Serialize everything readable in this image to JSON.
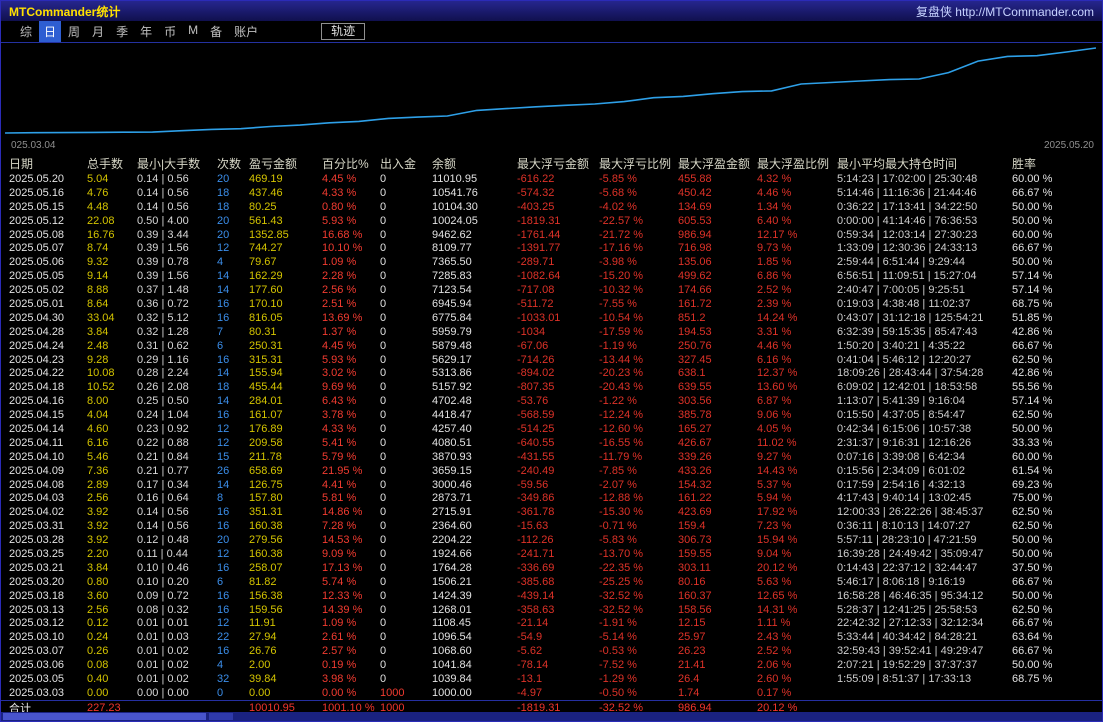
{
  "window": {
    "title": "MTCommander统计",
    "right_text": "复盘侠 http://MTCommander.com"
  },
  "menu": {
    "items": [
      {
        "label": "综",
        "key": "summary"
      },
      {
        "label": "日",
        "key": "day"
      },
      {
        "label": "周",
        "key": "week"
      },
      {
        "label": "月",
        "key": "month"
      },
      {
        "label": "季",
        "key": "quarter"
      },
      {
        "label": "年",
        "key": "year"
      },
      {
        "label": "币",
        "key": "currency"
      },
      {
        "label": "M",
        "key": "m"
      },
      {
        "label": "备",
        "key": "note"
      },
      {
        "label": "账户",
        "key": "account"
      }
    ],
    "active_index": 1,
    "track_button": "轨迹"
  },
  "chart": {
    "start_label": "025.03.04",
    "end_label": "2025.05.20",
    "line_color": "#2ea0e8"
  },
  "chart_data": {
    "type": "line",
    "title": "",
    "xlabel": "",
    "ylabel": "",
    "grid": false,
    "legend": false,
    "x_axis_labels_shown": [
      "025.03.04",
      "2025.05.20"
    ],
    "ylim": [
      1000,
      11011
    ],
    "x": [
      "2025.03.03",
      "2025.03.05",
      "2025.03.06",
      "2025.03.07",
      "2025.03.10",
      "2025.03.12",
      "2025.03.13",
      "2025.03.18",
      "2025.03.20",
      "2025.03.21",
      "2025.03.25",
      "2025.03.28",
      "2025.03.31",
      "2025.04.02",
      "2025.04.03",
      "2025.04.08",
      "2025.04.09",
      "2025.04.10",
      "2025.04.11",
      "2025.04.14",
      "2025.04.15",
      "2025.04.16",
      "2025.04.18",
      "2025.04.22",
      "2025.04.23",
      "2025.04.24",
      "2025.04.28",
      "2025.04.30",
      "2025.05.01",
      "2025.05.02",
      "2025.05.05",
      "2025.05.06",
      "2025.05.07",
      "2025.05.08",
      "2025.05.12",
      "2025.05.15",
      "2025.05.16",
      "2025.05.20"
    ],
    "values": [
      1000.0,
      1039.84,
      1041.84,
      1068.6,
      1096.54,
      1108.45,
      1268.01,
      1424.39,
      1506.21,
      1764.28,
      1924.66,
      2204.22,
      2364.6,
      2715.91,
      2873.71,
      3000.46,
      3659.15,
      3870.93,
      4080.51,
      4257.4,
      4418.47,
      4702.48,
      5157.92,
      5313.86,
      5629.17,
      5879.48,
      5959.79,
      6775.84,
      6945.94,
      7123.54,
      7285.83,
      7365.5,
      8109.77,
      9462.62,
      10024.05,
      10104.3,
      10541.76,
      11010.95
    ]
  },
  "table": {
    "headers": [
      "日期",
      "总手数",
      "最小|大手数",
      "次数",
      "盈亏金额",
      "百分比%",
      "出入金",
      "余额",
      "最大浮亏金额",
      "最大浮亏比例",
      "最大浮盈金额",
      "最大浮盈比例",
      "最小平均最大持仓时间",
      "胜率"
    ],
    "rows": [
      [
        "2025.05.20",
        "5.04",
        "0.14 | 0.56",
        "20",
        "469.19",
        "4.45 %",
        "0",
        "11010.95",
        "-616.22",
        "-5.85 %",
        "455.88",
        "4.32 %",
        "5:14:23 | 17:02:00 | 25:30:48",
        "60.00 %"
      ],
      [
        "2025.05.16",
        "4.76",
        "0.14 | 0.56",
        "18",
        "437.46",
        "4.33 %",
        "0",
        "10541.76",
        "-574.32",
        "-5.68 %",
        "450.42",
        "4.46 %",
        "5:14:46 | 11:16:36 | 21:44:46",
        "66.67 %"
      ],
      [
        "2025.05.15",
        "4.48",
        "0.14 | 0.56",
        "18",
        "80.25",
        "0.80 %",
        "0",
        "10104.30",
        "-403.25",
        "-4.02 %",
        "134.69",
        "1.34 %",
        "0:36:22 | 17:13:41 | 34:22:50",
        "50.00 %"
      ],
      [
        "2025.05.12",
        "22.08",
        "0.50 | 4.00",
        "20",
        "561.43",
        "5.93 %",
        "0",
        "10024.05",
        "-1819.31",
        "-22.57 %",
        "605.53",
        "6.40 %",
        "0:00:00 | 41:14:46 | 76:36:53",
        "50.00 %"
      ],
      [
        "2025.05.08",
        "16.76",
        "0.39 | 3.44",
        "20",
        "1352.85",
        "16.68 %",
        "0",
        "9462.62",
        "-1761.44",
        "-21.72 %",
        "986.94",
        "12.17 %",
        "0:59:34 | 12:03:14 | 27:30:23",
        "60.00 %"
      ],
      [
        "2025.05.07",
        "8.74",
        "0.39 | 1.56",
        "12",
        "744.27",
        "10.10 %",
        "0",
        "8109.77",
        "-1391.77",
        "-17.16 %",
        "716.98",
        "9.73 %",
        "1:33:09 | 12:30:36 | 24:33:13",
        "66.67 %"
      ],
      [
        "2025.05.06",
        "9.32",
        "0.39 | 0.78",
        "4",
        "79.67",
        "1.09 %",
        "0",
        "7365.50",
        "-289.71",
        "-3.98 %",
        "135.06",
        "1.85 %",
        "2:59:44 | 6:51:44 | 9:29:44",
        "50.00 %"
      ],
      [
        "2025.05.05",
        "9.14",
        "0.39 | 1.56",
        "14",
        "162.29",
        "2.28 %",
        "0",
        "7285.83",
        "-1082.64",
        "-15.20 %",
        "499.62",
        "6.86 %",
        "6:56:51 | 11:09:51 | 15:27:04",
        "57.14 %"
      ],
      [
        "2025.05.02",
        "8.88",
        "0.37 | 1.48",
        "14",
        "177.60",
        "2.56 %",
        "0",
        "7123.54",
        "-717.08",
        "-10.32 %",
        "174.66",
        "2.52 %",
        "2:40:47 | 7:00:05 | 9:25:51",
        "57.14 %"
      ],
      [
        "2025.05.01",
        "8.64",
        "0.36 | 0.72",
        "16",
        "170.10",
        "2.51 %",
        "0",
        "6945.94",
        "-511.72",
        "-7.55 %",
        "161.72",
        "2.39 %",
        "0:19:03 | 4:38:48 | 11:02:37",
        "68.75 %"
      ],
      [
        "2025.04.30",
        "33.04",
        "0.32 | 5.12",
        "16",
        "816.05",
        "13.69 %",
        "0",
        "6775.84",
        "-1033.01",
        "-10.54 %",
        "851.2",
        "14.24 %",
        "0:43:07 | 31:12:18 | 125:54:21",
        "51.85 %"
      ],
      [
        "2025.04.28",
        "3.84",
        "0.32 | 1.28",
        "7",
        "80.31",
        "1.37 %",
        "0",
        "5959.79",
        "-1034",
        "-17.59 %",
        "194.53",
        "3.31 %",
        "6:32:39 | 59:15:35 | 85:47:43",
        "42.86 %"
      ],
      [
        "2025.04.24",
        "2.48",
        "0.31 | 0.62",
        "6",
        "250.31",
        "4.45 %",
        "0",
        "5879.48",
        "-67.06",
        "-1.19 %",
        "250.76",
        "4.46 %",
        "1:50:20 | 3:40:21 | 4:35:22",
        "66.67 %"
      ],
      [
        "2025.04.23",
        "9.28",
        "0.29 | 1.16",
        "16",
        "315.31",
        "5.93 %",
        "0",
        "5629.17",
        "-714.26",
        "-13.44 %",
        "327.45",
        "6.16 %",
        "0:41:04 | 5:46:12 | 12:20:27",
        "62.50 %"
      ],
      [
        "2025.04.22",
        "10.08",
        "0.28 | 2.24",
        "14",
        "155.94",
        "3.02 %",
        "0",
        "5313.86",
        "-894.02",
        "-20.23 %",
        "638.1",
        "12.37 %",
        "18:09:26 | 28:43:44 | 37:54:28",
        "42.86 %"
      ],
      [
        "2025.04.18",
        "10.52",
        "0.26 | 2.08",
        "18",
        "455.44",
        "9.69 %",
        "0",
        "5157.92",
        "-807.35",
        "-20.43 %",
        "639.55",
        "13.60 %",
        "6:09:02 | 12:42:01 | 18:53:58",
        "55.56 %"
      ],
      [
        "2025.04.16",
        "8.00",
        "0.25 | 0.50",
        "14",
        "284.01",
        "6.43 %",
        "0",
        "4702.48",
        "-53.76",
        "-1.22 %",
        "303.56",
        "6.87 %",
        "1:13:07 | 5:41:39 | 9:16:04",
        "57.14 %"
      ],
      [
        "2025.04.15",
        "4.04",
        "0.24 | 1.04",
        "16",
        "161.07",
        "3.78 %",
        "0",
        "4418.47",
        "-568.59",
        "-12.24 %",
        "385.78",
        "9.06 %",
        "0:15:50 | 4:37:05 | 8:54:47",
        "62.50 %"
      ],
      [
        "2025.04.14",
        "4.60",
        "0.23 | 0.92",
        "12",
        "176.89",
        "4.33 %",
        "0",
        "4257.40",
        "-514.25",
        "-12.60 %",
        "165.27",
        "4.05 %",
        "0:42:34 | 6:15:06 | 10:57:38",
        "50.00 %"
      ],
      [
        "2025.04.11",
        "6.16",
        "0.22 | 0.88",
        "12",
        "209.58",
        "5.41 %",
        "0",
        "4080.51",
        "-640.55",
        "-16.55 %",
        "426.67",
        "11.02 %",
        "2:31:37 | 9:16:31 | 12:16:26",
        "33.33 %"
      ],
      [
        "2025.04.10",
        "5.46",
        "0.21 | 0.84",
        "15",
        "211.78",
        "5.79 %",
        "0",
        "3870.93",
        "-431.55",
        "-11.79 %",
        "339.26",
        "9.27 %",
        "0:07:16 | 3:39:08 | 6:42:34",
        "60.00 %"
      ],
      [
        "2025.04.09",
        "7.36",
        "0.21 | 0.77",
        "26",
        "658.69",
        "21.95 %",
        "0",
        "3659.15",
        "-240.49",
        "-7.85 %",
        "433.26",
        "14.43 %",
        "0:15:56 | 2:34:09 | 6:01:02",
        "61.54 %"
      ],
      [
        "2025.04.08",
        "2.89",
        "0.17 | 0.34",
        "14",
        "126.75",
        "4.41 %",
        "0",
        "3000.46",
        "-59.56",
        "-2.07 %",
        "154.32",
        "5.37 %",
        "0:17:59 | 2:54:16 | 4:32:13",
        "69.23 %"
      ],
      [
        "2025.04.03",
        "2.56",
        "0.16 | 0.64",
        "8",
        "157.80",
        "5.81 %",
        "0",
        "2873.71",
        "-349.86",
        "-12.88 %",
        "161.22",
        "5.94 %",
        "4:17:43 | 9:40:14 | 13:02:45",
        "75.00 %"
      ],
      [
        "2025.04.02",
        "3.92",
        "0.14 | 0.56",
        "16",
        "351.31",
        "14.86 %",
        "0",
        "2715.91",
        "-361.78",
        "-15.30 %",
        "423.69",
        "17.92 %",
        "12:00:33 | 26:22:26 | 38:45:37",
        "62.50 %"
      ],
      [
        "2025.03.31",
        "3.92",
        "0.14 | 0.56",
        "16",
        "160.38",
        "7.28 %",
        "0",
        "2364.60",
        "-15.63",
        "-0.71 %",
        "159.4",
        "7.23 %",
        "0:36:11 | 8:10:13 | 14:07:27",
        "62.50 %"
      ],
      [
        "2025.03.28",
        "3.92",
        "0.12 | 0.48",
        "20",
        "279.56",
        "14.53 %",
        "0",
        "2204.22",
        "-112.26",
        "-5.83 %",
        "306.73",
        "15.94 %",
        "5:57:11 | 28:23:10 | 47:21:59",
        "50.00 %"
      ],
      [
        "2025.03.25",
        "2.20",
        "0.11 | 0.44",
        "12",
        "160.38",
        "9.09 %",
        "0",
        "1924.66",
        "-241.71",
        "-13.70 %",
        "159.55",
        "9.04 %",
        "16:39:28 | 24:49:42 | 35:09:47",
        "50.00 %"
      ],
      [
        "2025.03.21",
        "3.84",
        "0.10 | 0.46",
        "16",
        "258.07",
        "17.13 %",
        "0",
        "1764.28",
        "-336.69",
        "-22.35 %",
        "303.11",
        "20.12 %",
        "0:14:43 | 22:37:12 | 32:44:47",
        "37.50 %"
      ],
      [
        "2025.03.20",
        "0.80",
        "0.10 | 0.20",
        "6",
        "81.82",
        "5.74 %",
        "0",
        "1506.21",
        "-385.68",
        "-25.25 %",
        "80.16",
        "5.63 %",
        "5:46:17 | 8:06:18 | 9:16:19",
        "66.67 %"
      ],
      [
        "2025.03.18",
        "3.60",
        "0.09 | 0.72",
        "16",
        "156.38",
        "12.33 %",
        "0",
        "1424.39",
        "-439.14",
        "-32.52 %",
        "160.37",
        "12.65 %",
        "16:58:28 | 46:46:35 | 95:34:12",
        "50.00 %"
      ],
      [
        "2025.03.13",
        "2.56",
        "0.08 | 0.32",
        "16",
        "159.56",
        "14.39 %",
        "0",
        "1268.01",
        "-358.63",
        "-32.52 %",
        "158.56",
        "14.31 %",
        "5:28:37 | 12:41:25 | 25:58:53",
        "62.50 %"
      ],
      [
        "2025.03.12",
        "0.12",
        "0.01 | 0.01",
        "12",
        "11.91",
        "1.09 %",
        "0",
        "1108.45",
        "-21.14",
        "-1.91 %",
        "12.15",
        "1.11 %",
        "22:42:32 | 27:12:33 | 32:12:34",
        "66.67 %"
      ],
      [
        "2025.03.10",
        "0.24",
        "0.01 | 0.03",
        "22",
        "27.94",
        "2.61 %",
        "0",
        "1096.54",
        "-54.9",
        "-5.14 %",
        "25.97",
        "2.43 %",
        "5:33:44 | 40:34:42 | 84:28:21",
        "63.64 %"
      ],
      [
        "2025.03.07",
        "0.26",
        "0.01 | 0.02",
        "16",
        "26.76",
        "2.57 %",
        "0",
        "1068.60",
        "-5.62",
        "-0.53 %",
        "26.23",
        "2.52 %",
        "32:59:43 | 39:52:41 | 49:29:47",
        "66.67 %"
      ],
      [
        "2025.03.06",
        "0.08",
        "0.01 | 0.02",
        "4",
        "2.00",
        "0.19 %",
        "0",
        "1041.84",
        "-78.14",
        "-7.52 %",
        "21.41",
        "2.06 %",
        "2:07:21 | 19:52:29 | 37:37:37",
        "50.00 %"
      ],
      [
        "2025.03.05",
        "0.40",
        "0.01 | 0.02",
        "32",
        "39.84",
        "3.98 %",
        "0",
        "1039.84",
        "-13.1",
        "-1.29 %",
        "26.4",
        "2.60 %",
        "1:55:09 | 8:51:37 | 17:33:13",
        "68.75 %"
      ],
      [
        "2025.03.03",
        "0.00",
        "0.00 | 0.00",
        "0",
        "0.00",
        "0.00 %",
        "1000",
        "1000.00",
        "-4.97",
        "-0.50 %",
        "1.74",
        "0.17 %",
        "",
        ""
      ]
    ],
    "total": [
      "合计",
      "227.23",
      "",
      "",
      "10010.95",
      "1001.10 %",
      "1000",
      "",
      "-1819.31",
      "-32.52 %",
      "986.94",
      "20.12 %",
      "",
      ""
    ]
  }
}
